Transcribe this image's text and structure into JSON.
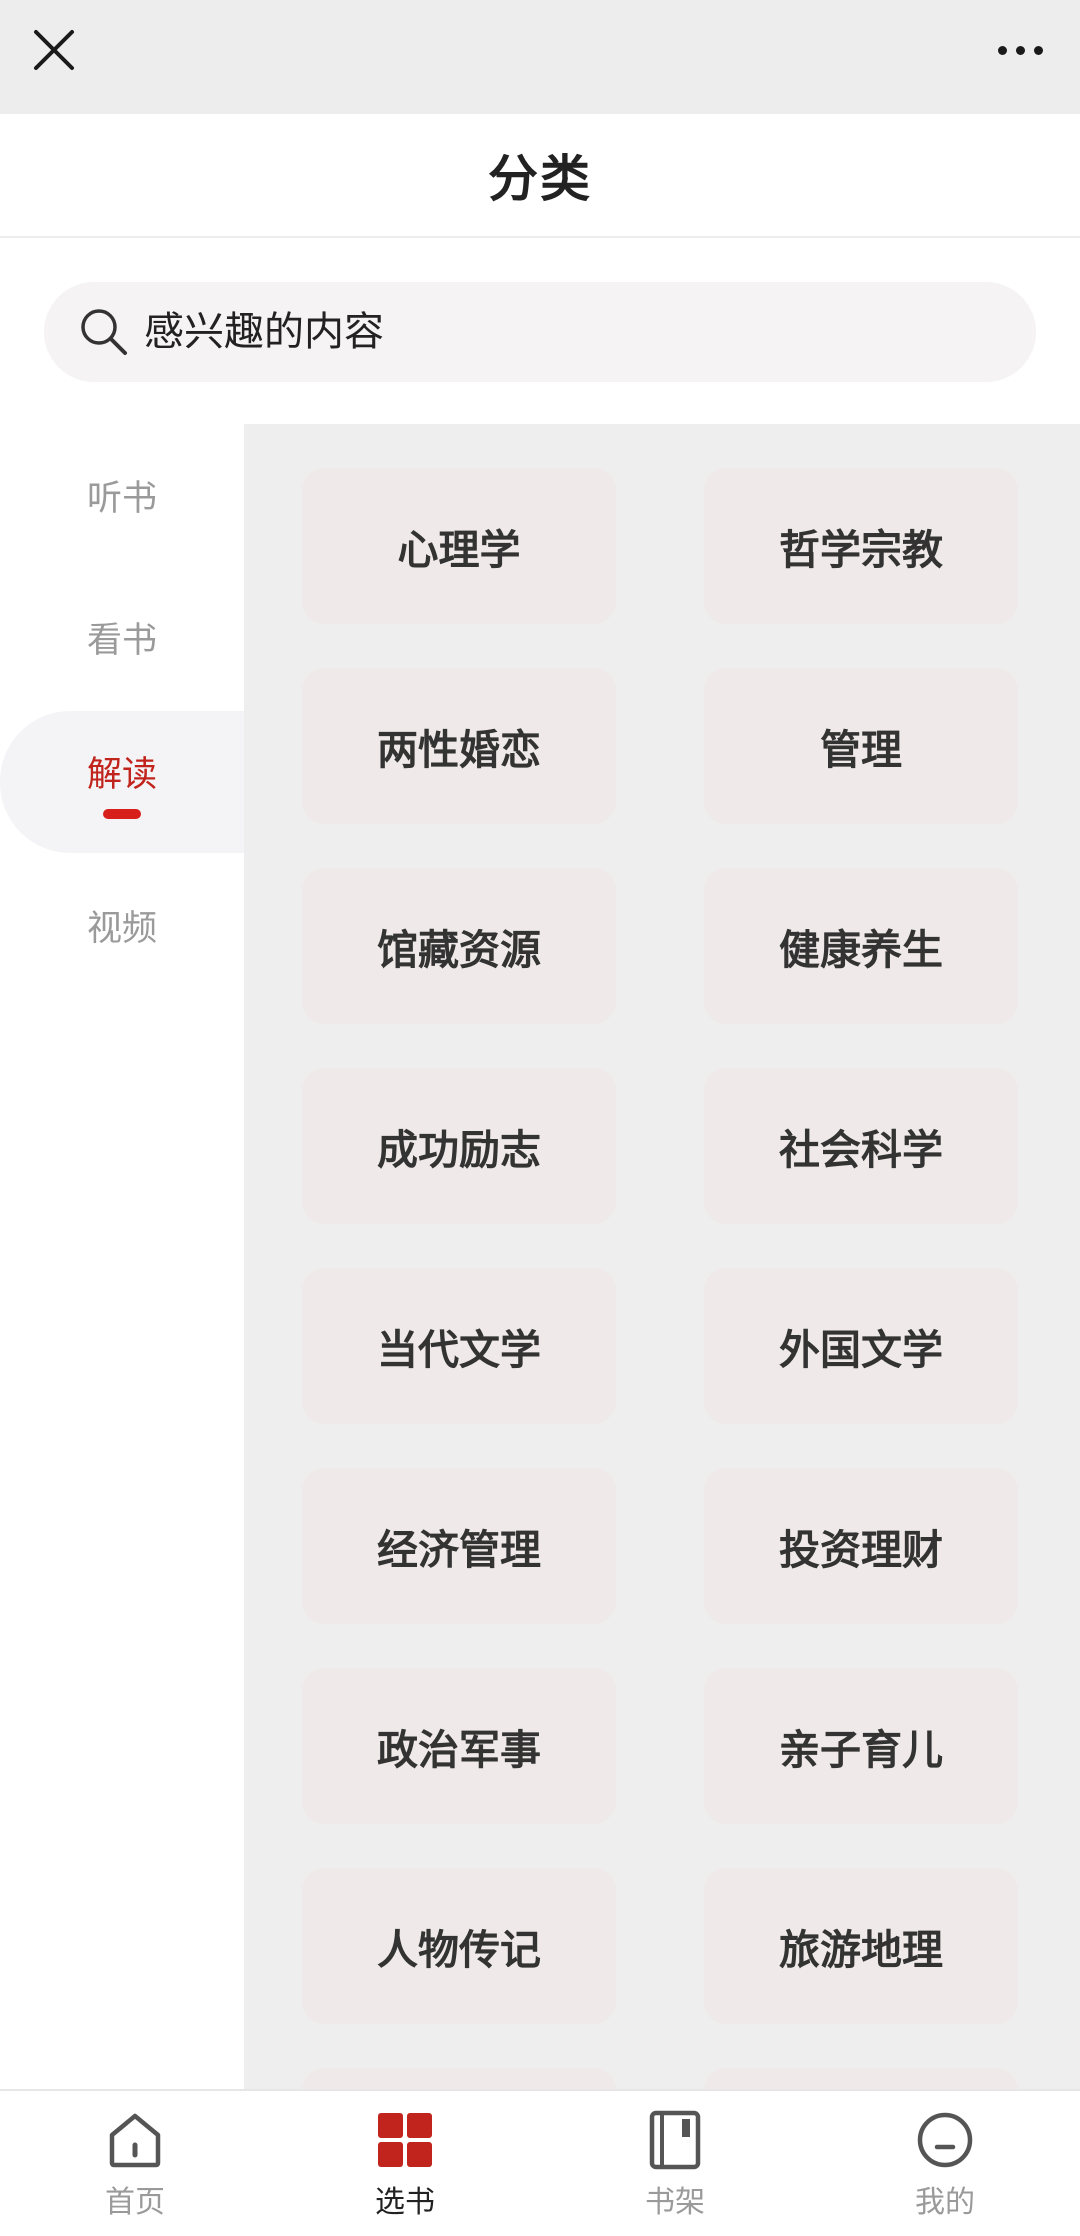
{
  "header": {
    "title": "分类"
  },
  "search": {
    "placeholder": "感兴趣的内容"
  },
  "sidebar": {
    "items": [
      {
        "label": "听书",
        "active": false
      },
      {
        "label": "看书",
        "active": false
      },
      {
        "label": "解读",
        "active": true
      },
      {
        "label": "视频",
        "active": false
      }
    ]
  },
  "categories": [
    "心理学",
    "哲学宗教",
    "两性婚恋",
    "管理",
    "馆藏资源",
    "健康养生",
    "成功励志",
    "社会科学",
    "当代文学",
    "外国文学",
    "经济管理",
    "投资理财",
    "政治军事",
    "亲子育儿",
    "人物传记",
    "旅游地理",
    "",
    ""
  ],
  "bottom_nav": [
    {
      "label": "首页",
      "icon": "home-icon",
      "active": false
    },
    {
      "label": "选书",
      "icon": "grid-icon",
      "active": true
    },
    {
      "label": "书架",
      "icon": "bookshelf-icon",
      "active": false
    },
    {
      "label": "我的",
      "icon": "profile-icon",
      "active": false
    }
  ],
  "colors": {
    "accent": "#d7201b",
    "active_text": "#c1241c"
  }
}
